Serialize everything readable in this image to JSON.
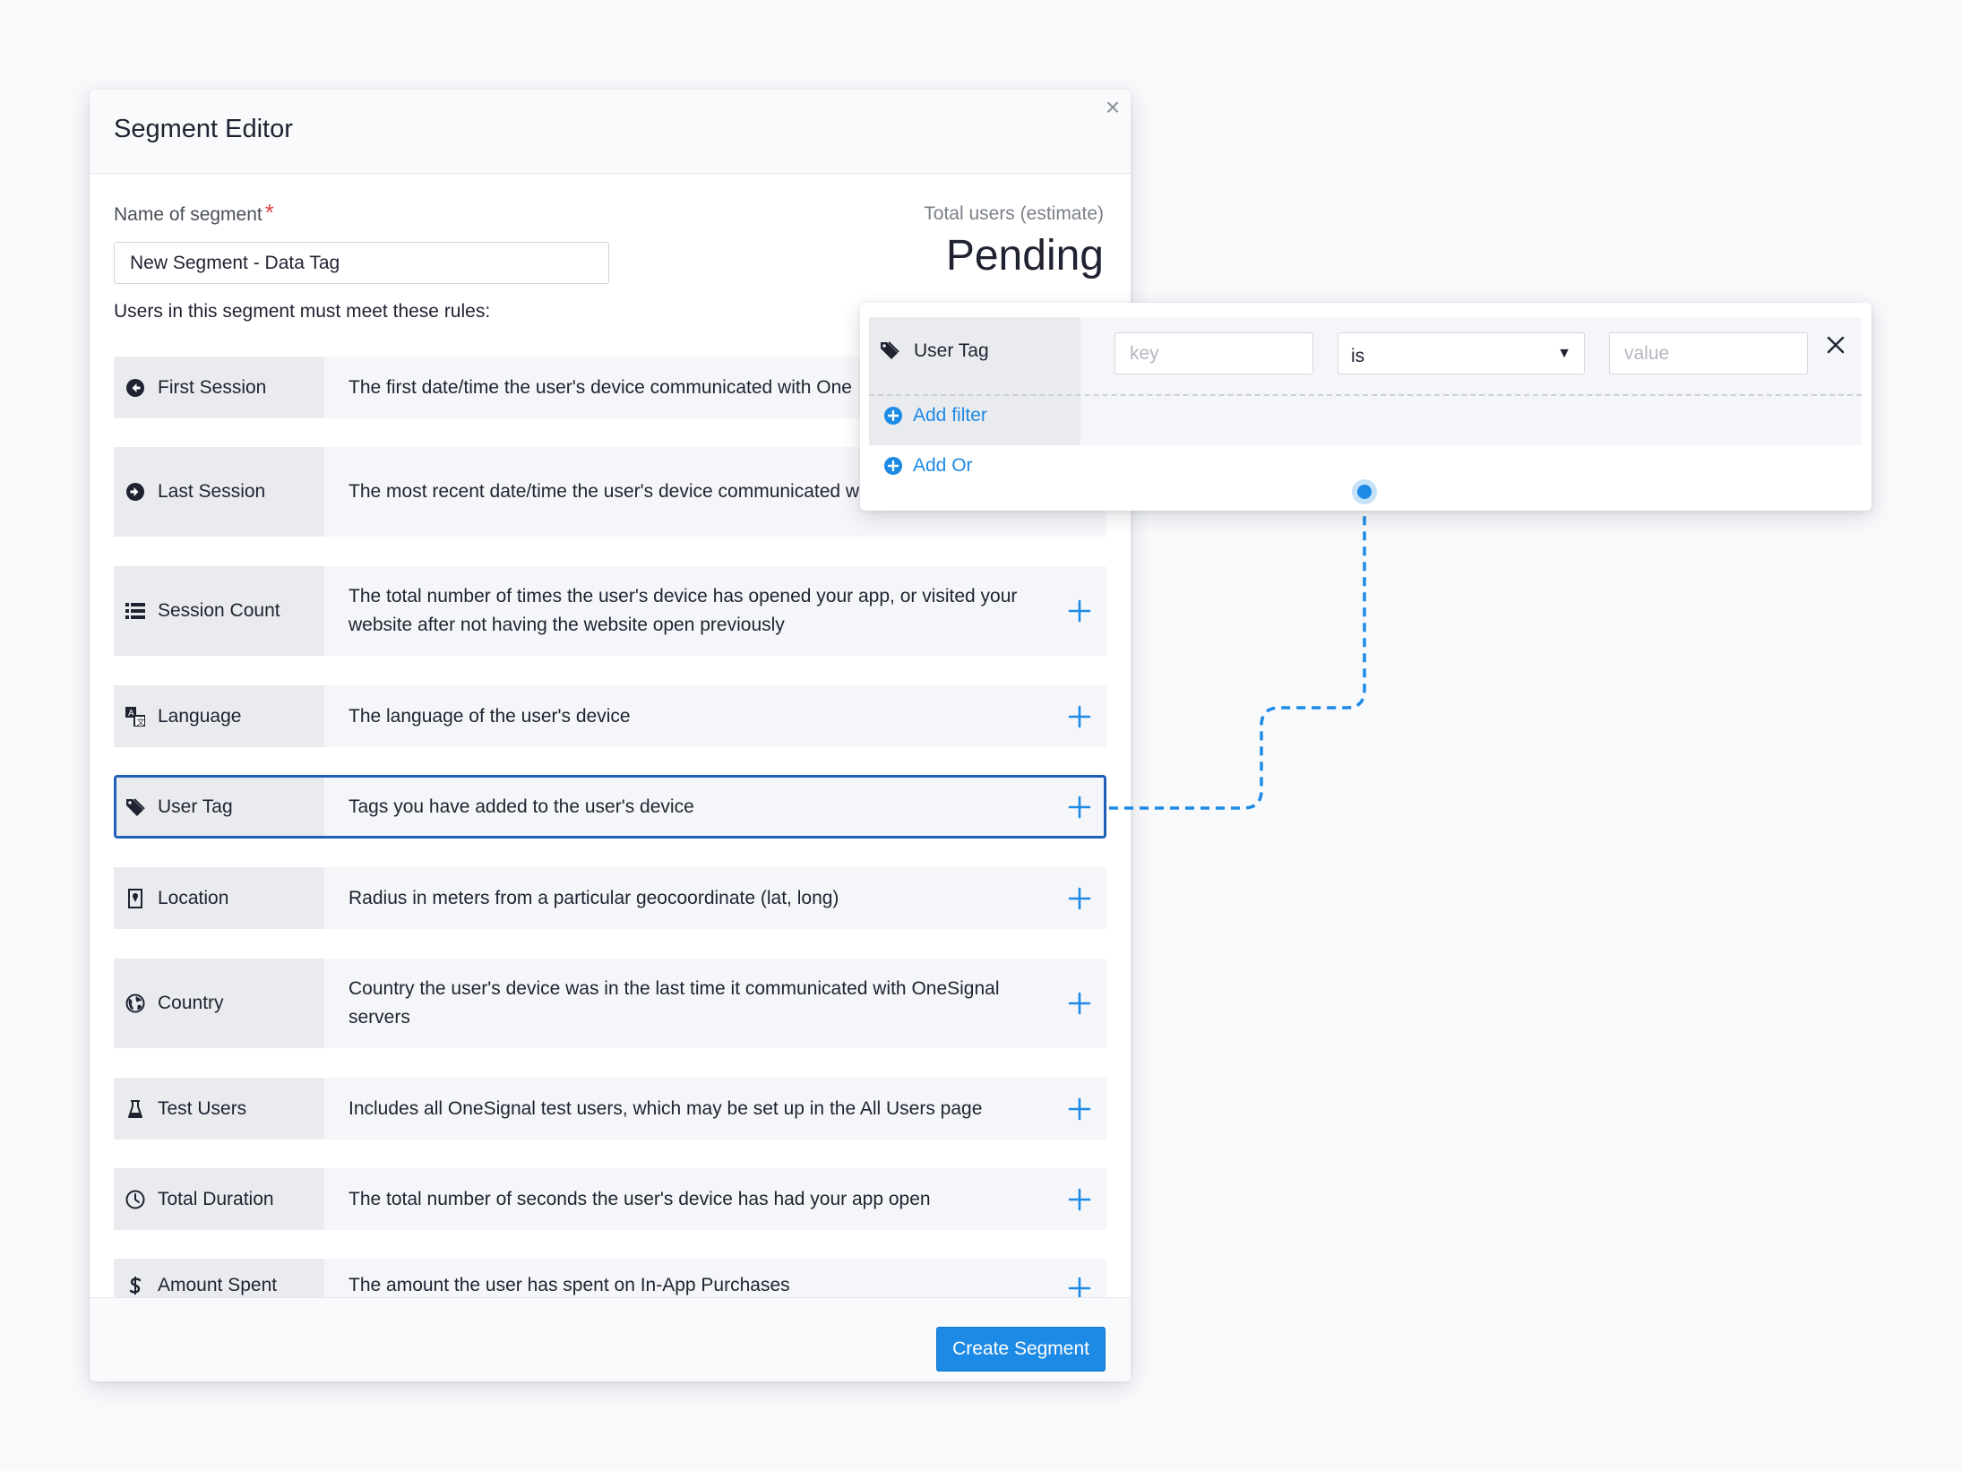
{
  "modal": {
    "title": "Segment Editor",
    "close_glyph": "×",
    "name_label": "Name of segment",
    "required_mark": "*",
    "name_value": "New Segment - Data Tag",
    "total_label": "Total users (estimate)",
    "total_value": "Pending",
    "rules_label": "Users in this segment must meet these rules:",
    "create_button": "Create Segment"
  },
  "rules": [
    {
      "name": "First Session",
      "icon": "first-session-icon",
      "desc": "The first date/time the user's device communicated with One"
    },
    {
      "name": "Last Session",
      "icon": "last-session-icon",
      "desc": "The most recent date/time the user's device communicated w servers"
    },
    {
      "name": "Session Count",
      "icon": "list-icon",
      "desc": "The total number of times the user's device has opened your app, or visited your website after not having the website open previously"
    },
    {
      "name": "Language",
      "icon": "language-icon",
      "desc": "The language of the user's device"
    },
    {
      "name": "User Tag",
      "icon": "tag-icon",
      "desc": "Tags you have added to the user's device"
    },
    {
      "name": "Location",
      "icon": "location-icon",
      "desc": "Radius in meters from a particular geocoordinate (lat, long)"
    },
    {
      "name": "Country",
      "icon": "globe-icon",
      "desc": "Country the user's device was in the last time it communicated with OneSignal servers"
    },
    {
      "name": "Test Users",
      "icon": "flask-icon",
      "desc": "Includes all OneSignal test users, which may be set up in the All Users page"
    },
    {
      "name": "Total Duration",
      "icon": "clock-icon",
      "desc": "The total number of seconds the user's device has had your app open"
    },
    {
      "name": "Amount Spent",
      "icon": "dollar-icon",
      "desc": "The amount the user has spent on In-App Purchases"
    }
  ],
  "filter": {
    "tag_label": "User Tag",
    "key_placeholder": "key",
    "operator_value": "is",
    "value_placeholder": "value",
    "add_filter": "Add filter",
    "add_or": "Add Or"
  },
  "colors": {
    "accent": "#1d8ae6",
    "active_border": "#1f5fb8",
    "required": "#e33f3f"
  }
}
